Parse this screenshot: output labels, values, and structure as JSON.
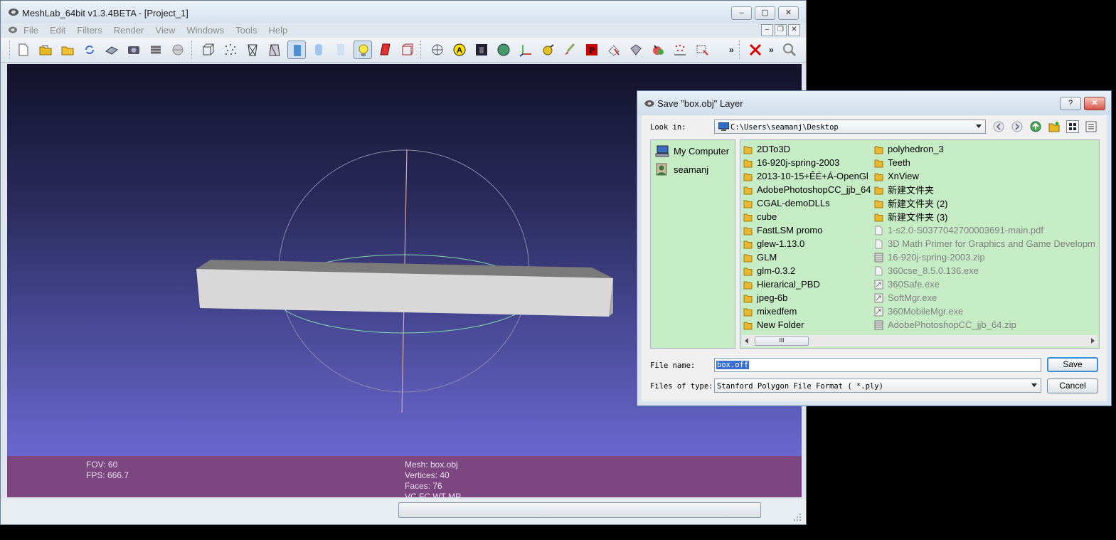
{
  "main": {
    "title": "MeshLab_64bit v1.3.4BETA - [Project_1]",
    "menus": [
      "File",
      "Edit",
      "Filters",
      "Render",
      "View",
      "Windows",
      "Tools",
      "Help"
    ],
    "window_buttons": {
      "minimize": "–",
      "maximize": "▢",
      "close": "✕"
    },
    "toolbar": {
      "more_1": "»",
      "more_2": "»"
    },
    "info": {
      "fov": "FOV: 60",
      "fps": "FPS:   666.7",
      "mesh": "Mesh: box.obj",
      "vertices": "Vertices: 40",
      "faces": "Faces: 76",
      "attributes": "VC FC WT MP"
    },
    "colors": {
      "viewport_top": "#12122a",
      "viewport_bottom": "#6a68cf",
      "infobar": "#7c4681"
    }
  },
  "dialog": {
    "title": "Save \"box.obj\" Layer",
    "help_button": "?",
    "close_button": "✕",
    "look_in_label": "Look in:",
    "look_in_value": "C:\\Users\\seamanj\\Desktop",
    "sidebar": [
      {
        "label": "My Computer",
        "icon": "computer-icon"
      },
      {
        "label": "seamanj",
        "icon": "user-icon"
      }
    ],
    "files_col1": [
      {
        "name": "2DTo3D",
        "type": "folder"
      },
      {
        "name": "16-920j-spring-2003",
        "type": "folder"
      },
      {
        "name": "2013-10-15+ÊÉ+Á-OpenGl",
        "type": "folder"
      },
      {
        "name": "AdobePhotoshopCC_jjb_64",
        "type": "folder"
      },
      {
        "name": "CGAL-demoDLLs",
        "type": "folder"
      },
      {
        "name": "cube",
        "type": "folder"
      },
      {
        "name": "FastLSM promo",
        "type": "folder"
      },
      {
        "name": "glew-1.13.0",
        "type": "folder"
      },
      {
        "name": "GLM",
        "type": "folder"
      },
      {
        "name": "glm-0.3.2",
        "type": "folder"
      },
      {
        "name": "Hierarical_PBD",
        "type": "folder"
      },
      {
        "name": "jpeg-6b",
        "type": "folder"
      },
      {
        "name": "mixedfem",
        "type": "folder"
      },
      {
        "name": "New Folder",
        "type": "folder"
      }
    ],
    "files_col2": [
      {
        "name": "polyhedron_3",
        "type": "folder"
      },
      {
        "name": "Teeth",
        "type": "folder"
      },
      {
        "name": "XnView",
        "type": "folder"
      },
      {
        "name": "新建文件夹",
        "type": "folder"
      },
      {
        "name": "新建文件夹 (2)",
        "type": "folder"
      },
      {
        "name": "新建文件夹 (3)",
        "type": "folder"
      },
      {
        "name": "1-s2.0-S0377042700003691-main.pdf",
        "type": "file"
      },
      {
        "name": "3D Math Primer for Graphics and Game Developm",
        "type": "file"
      },
      {
        "name": "16-920j-spring-2003.zip",
        "type": "zip"
      },
      {
        "name": "360cse_8.5.0.136.exe",
        "type": "file"
      },
      {
        "name": "360Safe.exe",
        "type": "exe"
      },
      {
        "name": "SoftMgr.exe",
        "type": "exe"
      },
      {
        "name": "360MobileMgr.exe",
        "type": "exe"
      },
      {
        "name": "AdobePhotoshopCC_jjb_64.zip",
        "type": "zip"
      }
    ],
    "scroll_thumb": "III",
    "file_name_label": "File name:",
    "file_name_value": "box.off",
    "file_type_label": "Files of type:",
    "file_type_value": "Stanford Polygon File Format ( *.ply)",
    "save_label": "Save",
    "cancel_label": "Cancel"
  }
}
